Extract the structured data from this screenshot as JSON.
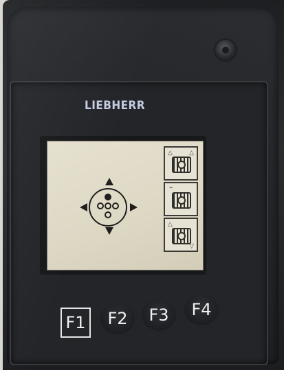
{
  "brand": {
    "logo_text": "LIEBHERR"
  },
  "display": {
    "main_icon": "joystick-arrows-icon",
    "side_buttons": [
      {
        "icon": "track-raise-icon"
      },
      {
        "icon": "track-gear-icon"
      },
      {
        "icon": "track-lower-icon"
      }
    ]
  },
  "function_keys": [
    {
      "label": "F1",
      "selected": true
    },
    {
      "label": "F2",
      "selected": false
    },
    {
      "label": "F3",
      "selected": false
    },
    {
      "label": "F4",
      "selected": false
    }
  ],
  "colors": {
    "display_background": "#e2ddca",
    "bezel": "#232529",
    "key_text": "#f0f0f0"
  }
}
